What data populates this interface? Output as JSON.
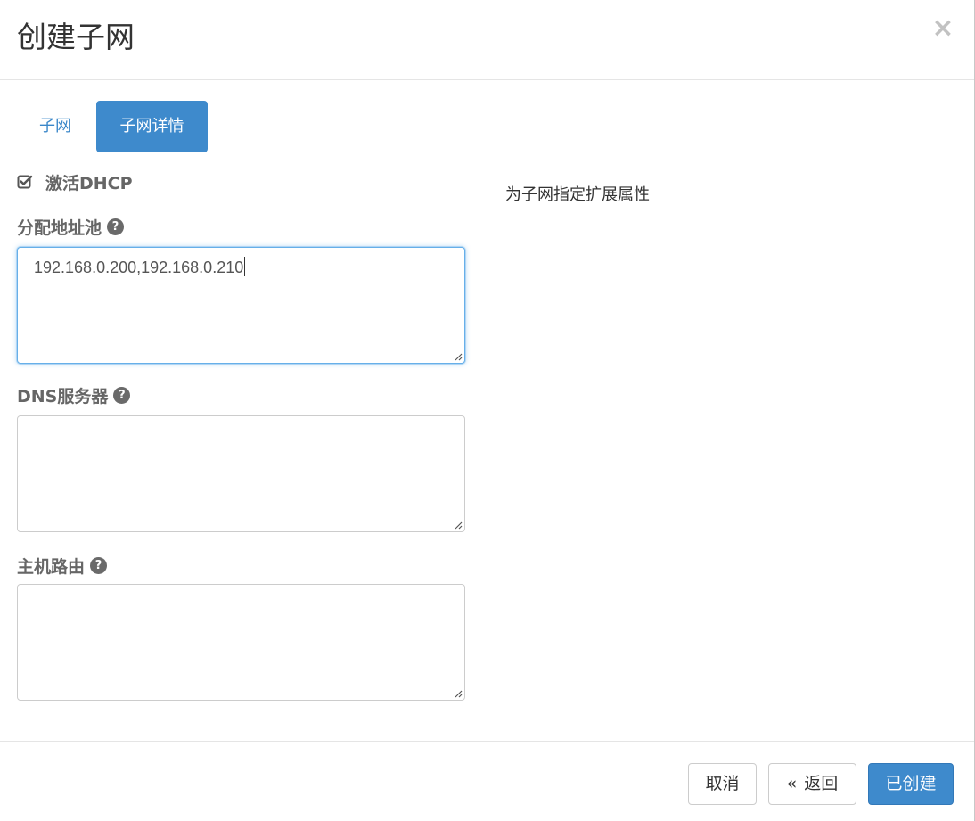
{
  "dialog": {
    "title": "创建子网",
    "close_icon": "×"
  },
  "tabs": [
    {
      "label": "子网",
      "active": false
    },
    {
      "label": "子网详情",
      "active": true
    }
  ],
  "form": {
    "enable_dhcp": {
      "label": "激活DHCP",
      "checked": true
    },
    "allocation_pools": {
      "label": "分配地址池",
      "value": "192.168.0.200,192.168.0.210"
    },
    "dns_servers": {
      "label": "DNS服务器",
      "value": ""
    },
    "host_routes": {
      "label": "主机路由",
      "value": ""
    },
    "help_icon": "?"
  },
  "help_text": "为子网指定扩展属性",
  "footer": {
    "cancel_label": "取消",
    "back_icon": "«",
    "back_label": "返回",
    "create_label": "已创建"
  },
  "colors": {
    "primary": "#3e8acc",
    "link": "#3a87c9",
    "focus_border": "#66afe9"
  }
}
